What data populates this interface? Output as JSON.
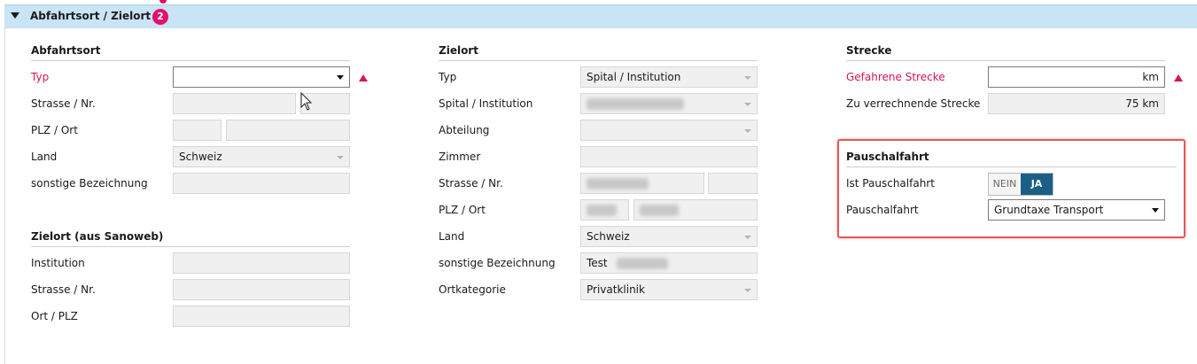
{
  "header": {
    "title": "Abfahrtsort / Zielort",
    "badge": "2"
  },
  "abfahrtsort": {
    "title": "Abfahrtsort",
    "typ_label": "Typ",
    "typ_value": "",
    "strasse_label": "Strasse / Nr.",
    "plz_label": "PLZ / Ort",
    "land_label": "Land",
    "land_value": "Schweiz",
    "sonstige_label": "sonstige Bezeichnung"
  },
  "zielort_sanoweb": {
    "title": "Zielort (aus Sanoweb)",
    "institution_label": "Institution",
    "strasse_label": "Strasse / Nr.",
    "ort_label": "Ort / PLZ"
  },
  "zielort": {
    "title": "Zielort",
    "typ_label": "Typ",
    "typ_value": "Spital / Institution",
    "spital_label": "Spital / Institution",
    "abteilung_label": "Abteilung",
    "zimmer_label": "Zimmer",
    "strasse_label": "Strasse / Nr.",
    "plz_label": "PLZ / Ort",
    "land_label": "Land",
    "land_value": "Schweiz",
    "sonstige_label": "sonstige Bezeichnung",
    "sonstige_value": "Test",
    "ortkategorie_label": "Ortkategorie",
    "ortkategorie_value": "Privatklinik"
  },
  "strecke": {
    "title": "Strecke",
    "gefahrene_label": "Gefahrene Strecke",
    "gefahrene_value": "km",
    "verrechnende_label": "Zu verrechnende Strecke",
    "verrechnende_value": "75 km"
  },
  "pauschalfahrt": {
    "title": "Pauschalfahrt",
    "ist_label": "Ist Pauschalfahrt",
    "toggle_off": "NEIN",
    "toggle_on": "JA",
    "toggle_state": "JA",
    "select_label": "Pauschalfahrt",
    "select_value": "Grundtaxe Transport"
  },
  "colors": {
    "header_bg": "#c9e4f4",
    "accent_required": "#d4145a",
    "badge": "#e2126b",
    "toggle_active": "#1c5f86",
    "highlight": "#e05a5a"
  }
}
